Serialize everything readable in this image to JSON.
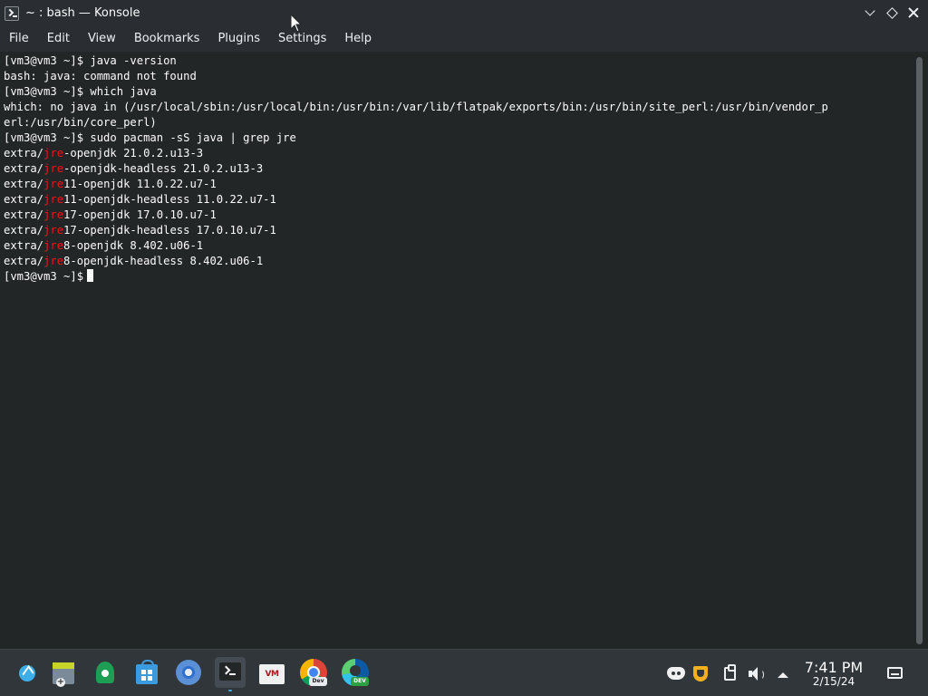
{
  "window": {
    "title": "~ : bash — Konsole",
    "app_icon": "konsole-icon"
  },
  "menu": [
    "File",
    "Edit",
    "View",
    "Bookmarks",
    "Plugins",
    "Settings",
    "Help"
  ],
  "terminal": {
    "highlight_color": "#ed1515",
    "lines": [
      {
        "text": "[vm3@vm3 ~]$ java -version"
      },
      {
        "text": "bash: java: command not found"
      },
      {
        "text": "[vm3@vm3 ~]$ which java"
      },
      {
        "text": "which: no java in (/usr/local/sbin:/usr/local/bin:/usr/bin:/var/lib/flatpak/exports/bin:/usr/bin/site_perl:/usr/bin/vendor_p"
      },
      {
        "text": "erl:/usr/bin/core_perl)"
      },
      {
        "text": "[vm3@vm3 ~]$ sudo pacman -sS java | grep jre"
      },
      {
        "pre": "extra/",
        "hl": "jre",
        "post": "-openjdk 21.0.2.u13-3"
      },
      {
        "pre": "extra/",
        "hl": "jre",
        "post": "-openjdk-headless 21.0.2.u13-3"
      },
      {
        "pre": "extra/",
        "hl": "jre",
        "post": "11-openjdk 11.0.22.u7-1"
      },
      {
        "pre": "extra/",
        "hl": "jre",
        "post": "11-openjdk-headless 11.0.22.u7-1"
      },
      {
        "pre": "extra/",
        "hl": "jre",
        "post": "17-openjdk 17.0.10.u7-1"
      },
      {
        "pre": "extra/",
        "hl": "jre",
        "post": "17-openjdk-headless 17.0.10.u7-1"
      },
      {
        "pre": "extra/",
        "hl": "jre",
        "post": "8-openjdk 8.402.u06-1"
      },
      {
        "pre": "extra/",
        "hl": "jre",
        "post": "8-openjdk-headless 8.402.u06-1"
      }
    ],
    "prompt": "[vm3@vm3 ~]$"
  },
  "taskbar": {
    "apps": [
      {
        "name": "application-launcher"
      },
      {
        "name": "ark-archiver"
      },
      {
        "name": "system-settings"
      },
      {
        "name": "discover-store"
      },
      {
        "name": "chromium"
      },
      {
        "name": "konsole",
        "active": true
      },
      {
        "name": "vmware"
      },
      {
        "name": "chrome-dev"
      },
      {
        "name": "edge-dev"
      }
    ],
    "chrome_dev_tag": "Dev",
    "edge_dev_tag": "DEV",
    "vm_label": "VM"
  },
  "tray": {
    "icons": [
      "discord-icon",
      "shield-icon",
      "clipboard-icon",
      "volume-icon",
      "expand-tray-icon"
    ],
    "time": "7:41 PM",
    "date": "2/15/24"
  }
}
